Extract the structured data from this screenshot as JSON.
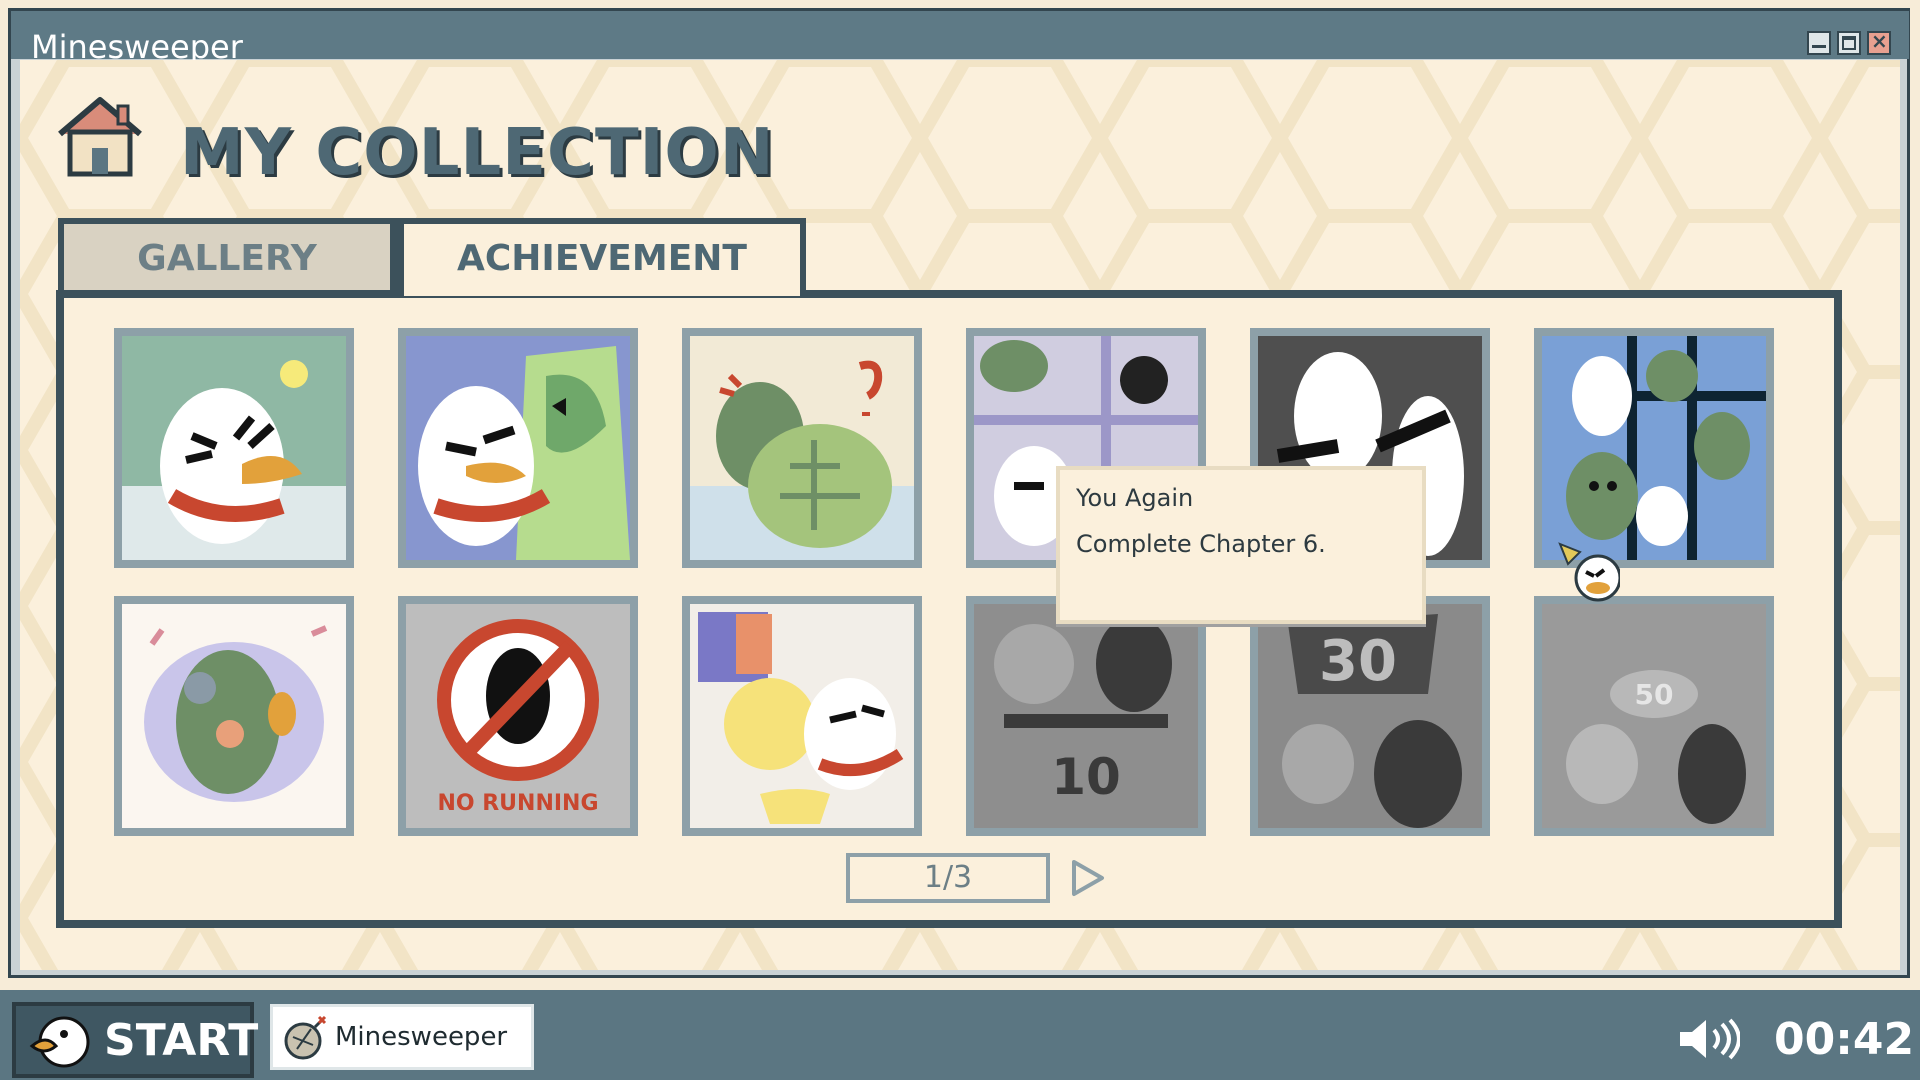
{
  "window": {
    "title": "Minesweeper",
    "minimize_icon": "minimize-icon",
    "maximize_icon": "maximize-icon",
    "close_icon": "close-icon"
  },
  "header": {
    "icon": "house-icon",
    "title": "MY COLLECTION"
  },
  "tabs": [
    {
      "label": "GALLERY",
      "active": false
    },
    {
      "label": "ACHIEVEMENT",
      "active": true
    }
  ],
  "achievements": [
    {
      "name": "duck-idea",
      "unlocked": true
    },
    {
      "name": "duck-and-dino",
      "unlocked": true
    },
    {
      "name": "turtle-dino",
      "unlocked": true
    },
    {
      "name": "you-again",
      "unlocked": true
    },
    {
      "name": "silhouette-duck",
      "unlocked": false
    },
    {
      "name": "dino-crowd",
      "unlocked": true
    },
    {
      "name": "dino-music",
      "unlocked": true
    },
    {
      "name": "no-running",
      "unlocked": true
    },
    {
      "name": "duck-trophy",
      "unlocked": true
    },
    {
      "name": "ten-scoreboard",
      "unlocked": false
    },
    {
      "name": "thirty-flag",
      "unlocked": false
    },
    {
      "name": "fifty-celebration",
      "unlocked": false
    }
  ],
  "tooltip": {
    "title": "You Again",
    "description": "Complete Chapter 6."
  },
  "pager": {
    "text": "1/3",
    "next_icon": "next-arrow-icon"
  },
  "taskbar": {
    "start_label": "START",
    "start_icon": "duck-icon",
    "task_label": "Minesweeper",
    "task_icon": "bomb-icon",
    "volume_icon": "volume-icon",
    "clock": "00:42"
  },
  "colors": {
    "accent": "#3c515b",
    "titlebar": "#5e7a86",
    "background": "#fbf0dc",
    "card_border": "#8da0a8"
  }
}
